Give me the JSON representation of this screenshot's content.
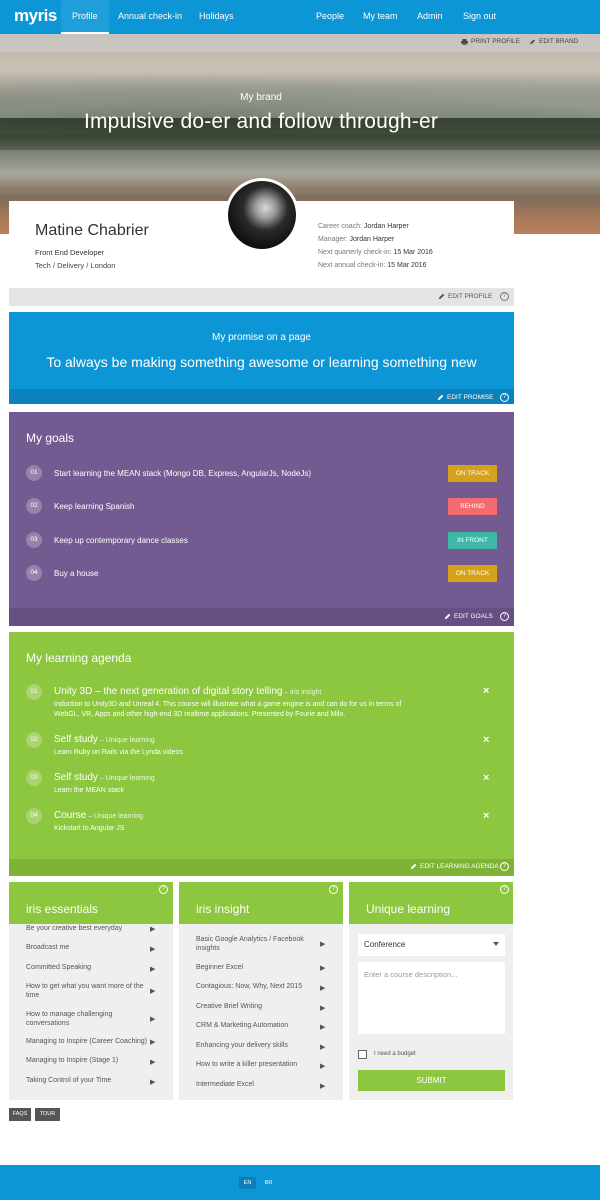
{
  "nav": {
    "logo": "myris",
    "left_items": [
      "Profile",
      "Annual check-in",
      "Holidays"
    ],
    "right_items": [
      "People",
      "My team",
      "Admin",
      "Sign out"
    ],
    "active": "Profile"
  },
  "hero": {
    "print_label": "PRINT PROFILE",
    "edit_label": "EDIT BRAND",
    "brand_label": "My brand",
    "brand_title": "Impulsive do-er and follow through-er"
  },
  "profile": {
    "name": "Matine Chabrier",
    "role": "Front End Developer",
    "location": "Tech / Delivery / London",
    "meta": [
      {
        "label": "Career coach: ",
        "value": "Jordan Harper"
      },
      {
        "label": "Manager: ",
        "value": "Jordan Harper"
      },
      {
        "label": "Next quarterly check-in: ",
        "value": "15 Mar 2016"
      },
      {
        "label": "Next annual check-in: ",
        "value": "15 Mar 2016"
      }
    ],
    "edit_label": "EDIT PROFILE"
  },
  "promise": {
    "label": "My promise on a page",
    "text": "To always be making something awesome or learning something new",
    "edit_label": "EDIT PROMISE"
  },
  "goals": {
    "title": "My goals",
    "items": [
      {
        "num": "01",
        "text": "Start learning the MEAN stack (Mongo DB, Express, AngularJs, NodeJs)",
        "status": "ON TRACK",
        "color": "#d6a21b"
      },
      {
        "num": "02",
        "text": "Keep learning Spanish",
        "status": "BEHIND",
        "color": "#f16b6f"
      },
      {
        "num": "03",
        "text": "Keep up contemporary dance classes",
        "status": "IN FRONT",
        "color": "#3fb7a8"
      },
      {
        "num": "04",
        "text": "Buy a house",
        "status": "ON TRACK",
        "color": "#d6a21b"
      }
    ],
    "edit_label": "EDIT GOALS"
  },
  "agenda": {
    "title": "My learning agenda",
    "items": [
      {
        "num": "01",
        "title": "Unity 3D – the next generation of digital story telling",
        "source": " – iris insight",
        "desc1": "Induction to Unity3D and Unreal 4. This course will illustrate what a game engine is and can do for us in terms of",
        "desc2": "WebGL, VR, Apps and other high-end 3D realtime applications. Presented by Fourie and Milo."
      },
      {
        "num": "02",
        "title": "Self study",
        "source": " – Unique learning",
        "desc1": "Learn Ruby on Rails via the Lynda videos",
        "desc2": ""
      },
      {
        "num": "03",
        "title": "Self study",
        "source": " – Unique learning",
        "desc1": "Learn the MEAN stack",
        "desc2": ""
      },
      {
        "num": "04",
        "title": "Course",
        "source": " – Unique learning",
        "desc1": "Kickstart to Angular JS",
        "desc2": ""
      }
    ],
    "close_glyph": "×",
    "edit_label": "EDIT LEARNING AGENDA"
  },
  "essentials": {
    "title": "iris essentials",
    "items": [
      "Be your creative best everyday",
      "Broadcast me",
      "Committed Speaking",
      "How to get what you want more of the time",
      "How to manage challenging conversations",
      "Managing to Inspire (Career Coaching)",
      "Managing to Inspire (Stage 1)",
      "Taking Control of your Time"
    ]
  },
  "insight": {
    "title": "iris insight",
    "items": [
      "Basic Google Analytics / Facebook insights",
      "Beginner Excel",
      "Contagious: Now, Why, Next 2015",
      "Creative Brief Writing",
      "CRM & Marketing Automation",
      "Enhancing your delivery skills",
      "How to write a killer presentation",
      "Intermediate Excel"
    ]
  },
  "unique": {
    "title": "Unique learning",
    "select_value": "Conference",
    "textarea_placeholder": "Enter a course description...",
    "budget_label": "I need a budget",
    "submit_label": "SUBMIT"
  },
  "buttons": {
    "faqs": "FAQS",
    "tour": "TOUR"
  },
  "footer": {
    "languages": [
      "EN",
      "BR"
    ],
    "active": "EN"
  },
  "colors": {
    "blue": "#0d96d6",
    "purple": "#735a91",
    "green": "#8dc63f"
  }
}
